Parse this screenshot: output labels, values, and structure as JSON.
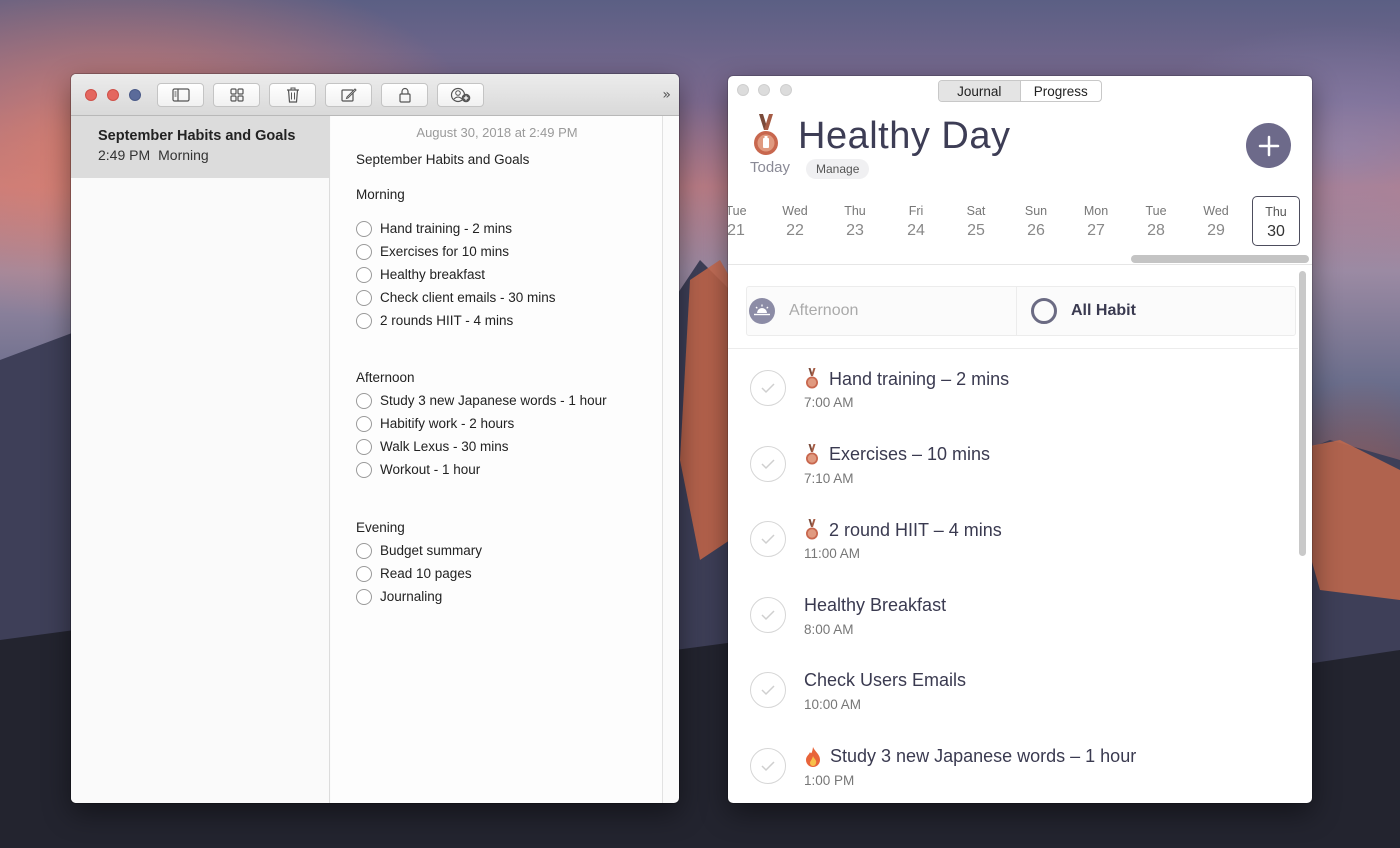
{
  "notes": {
    "toolbar": {
      "icons": [
        "sidebar-icon",
        "grid-icon",
        "trash-icon",
        "compose-icon",
        "lock-icon",
        "add-person-icon"
      ],
      "more_label": "»"
    },
    "sidebar": {
      "items": [
        {
          "title": "September Habits and Goals",
          "time": "2:49 PM",
          "preview": "Morning"
        }
      ]
    },
    "content": {
      "date": "August 30, 2018 at 2:49 PM",
      "title": "September Habits and Goals",
      "morning": {
        "heading": "Morning",
        "items": [
          "Hand training - 2 mins",
          "Exercises for 10 mins",
          "Healthy breakfast",
          "Check client emails - 30 mins",
          "2 rounds HIIT - 4 mins"
        ]
      },
      "afternoon": {
        "heading": "Afternoon",
        "items": [
          "Study 3 new Japanese words - 1 hour",
          "Habitify work - 2 hours",
          "Walk Lexus - 30 mins",
          "Workout - 1 hour"
        ]
      },
      "evening": {
        "heading": "Evening",
        "items": [
          "Budget summary",
          "Read 10 pages",
          "Journaling"
        ]
      }
    }
  },
  "habitify": {
    "segments": [
      "Journal",
      "Progress"
    ],
    "active_segment": "Journal",
    "title": "Healthy Day",
    "today_label": "Today",
    "manage_label": "Manage",
    "add_label": "+",
    "dates": [
      {
        "day": "Tue",
        "num": "21"
      },
      {
        "day": "Wed",
        "num": "22"
      },
      {
        "day": "Thu",
        "num": "23"
      },
      {
        "day": "Fri",
        "num": "24"
      },
      {
        "day": "Sat",
        "num": "25"
      },
      {
        "day": "Sun",
        "num": "26"
      },
      {
        "day": "Mon",
        "num": "27"
      },
      {
        "day": "Tue",
        "num": "28"
      },
      {
        "day": "Wed",
        "num": "29"
      },
      {
        "day": "Thu",
        "num": "30",
        "selected": true
      }
    ],
    "filter": {
      "left_label": "Afternoon",
      "right_label": "All Habit"
    },
    "habits": [
      {
        "icon": "medal-icon",
        "name": "Hand training – 2 mins",
        "time": "7:00 AM"
      },
      {
        "icon": "medal-icon",
        "name": "Exercises – 10 mins",
        "time": "7:10 AM"
      },
      {
        "icon": "medal-icon",
        "name": "2 round HIIT – 4 mins",
        "time": "11:00 AM"
      },
      {
        "icon": "",
        "name": "Healthy Breakfast",
        "time": "8:00 AM"
      },
      {
        "icon": "",
        "name": "Check Users Emails",
        "time": "10:00 AM"
      },
      {
        "icon": "fire-icon",
        "name": "Study 3 new Japanese words – 1 hour",
        "time": "1:00 PM"
      }
    ],
    "colors": {
      "accent": "#6d6a8a",
      "title": "#3d3d55",
      "medal": "#c8674e"
    }
  }
}
